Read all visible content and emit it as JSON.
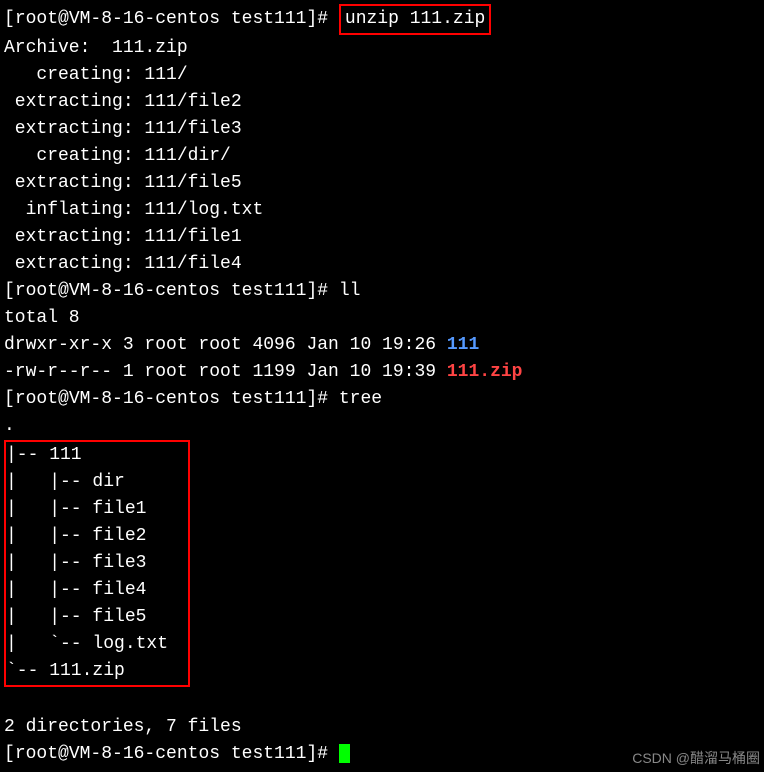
{
  "prompt1": {
    "bracket_open": "[",
    "user_host": "root@VM-8-16-centos test111",
    "bracket_close": "]#",
    "space": " ",
    "cmd": "unzip 111.zip"
  },
  "unzip_output": {
    "archive_line": "Archive:  111.zip",
    "lines": [
      "   creating: 111/",
      " extracting: 111/file2",
      " extracting: 111/file3",
      "   creating: 111/dir/",
      " extracting: 111/file5",
      "  inflating: 111/log.txt",
      " extracting: 111/file1",
      " extracting: 111/file4"
    ]
  },
  "prompt2": {
    "bracket_open": "[",
    "user_host": "root@VM-8-16-centos test111",
    "bracket_close": "]#",
    "cmd": " ll"
  },
  "ll_output": {
    "total": "total 8",
    "row1": {
      "perms": "drwxr-xr-x 3 root root 4096 Jan 10 19:26 ",
      "name": "111"
    },
    "row2": {
      "perms": "-rw-r--r-- 1 root root 1199 Jan 10 19:39 ",
      "name": "111.zip"
    }
  },
  "prompt3": {
    "bracket_open": "[",
    "user_host": "root@VM-8-16-centos test111",
    "bracket_close": "]#",
    "cmd": " tree"
  },
  "tree_output": {
    "dot_line": ".",
    "lines": [
      "|-- 111",
      "|   |-- dir",
      "|   |-- file1",
      "|   |-- file2",
      "|   |-- file3",
      "|   |-- file4",
      "|   |-- file5",
      "|   `-- log.txt",
      "`-- 111.zip"
    ],
    "summary": "2 directories, 7 files"
  },
  "prompt4": {
    "bracket_open": "[",
    "user_host": "root@VM-8-16-centos test111",
    "bracket_close": "]#",
    "cmd": " "
  },
  "watermark": "CSDN @醋溜马桶圈"
}
